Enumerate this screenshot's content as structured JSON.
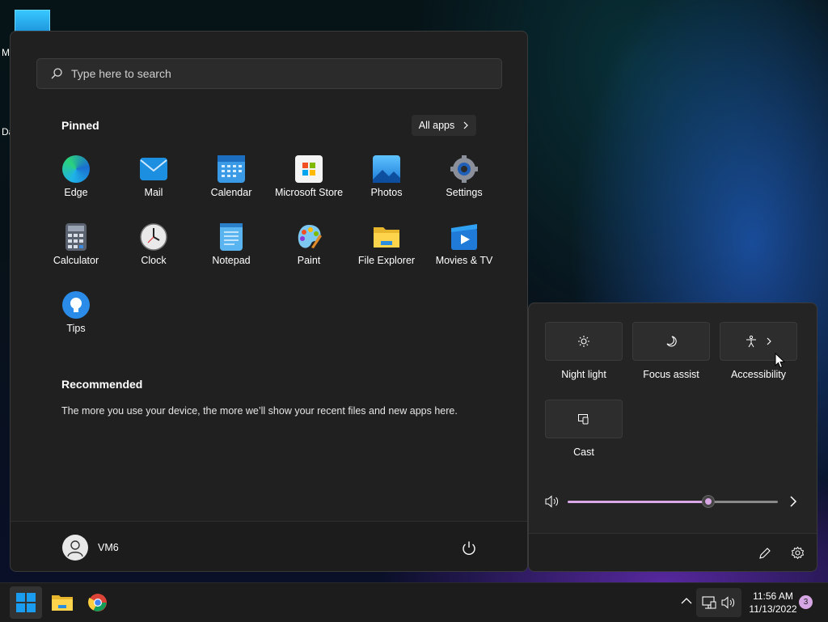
{
  "desktop": {
    "labels": [
      "M",
      "Da"
    ]
  },
  "start_menu": {
    "search_placeholder": "Type here to search",
    "pinned_title": "Pinned",
    "all_apps_label": "All apps",
    "pinned_apps": [
      {
        "label": "Edge",
        "icon": "edge-icon"
      },
      {
        "label": "Mail",
        "icon": "mail-icon"
      },
      {
        "label": "Calendar",
        "icon": "calendar-icon"
      },
      {
        "label": "Microsoft Store",
        "icon": "store-icon"
      },
      {
        "label": "Photos",
        "icon": "photos-icon"
      },
      {
        "label": "Settings",
        "icon": "settings-icon"
      },
      {
        "label": "Calculator",
        "icon": "calculator-icon"
      },
      {
        "label": "Clock",
        "icon": "clock-icon"
      },
      {
        "label": "Notepad",
        "icon": "notepad-icon"
      },
      {
        "label": "Paint",
        "icon": "paint-icon"
      },
      {
        "label": "File Explorer",
        "icon": "folder-icon"
      },
      {
        "label": "Movies & TV",
        "icon": "movies-icon"
      },
      {
        "label": "Tips",
        "icon": "tips-icon"
      }
    ],
    "recommended_title": "Recommended",
    "recommended_text": "The more you use your device, the more we’ll show your recent files and new apps here.",
    "user_name": "VM6"
  },
  "quick_settings": {
    "tiles": [
      {
        "label": "Night light",
        "icon": "night-light-icon"
      },
      {
        "label": "Focus assist",
        "icon": "moon-icon"
      },
      {
        "label": "Accessibility",
        "icon": "accessibility-icon"
      },
      {
        "label": "Cast",
        "icon": "cast-icon"
      }
    ],
    "volume_level": 0.67
  },
  "taskbar": {
    "time": "11:56 AM",
    "date": "11/13/2022",
    "notification_count": "3"
  },
  "colors": {
    "accent": "#d9a6e6",
    "start_bg": "#202020",
    "windows_blue": "#1a9cf0"
  }
}
